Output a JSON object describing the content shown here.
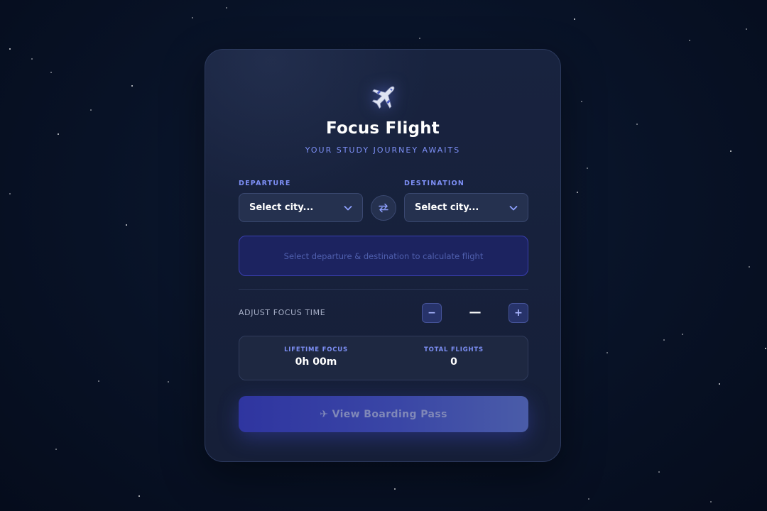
{
  "app": {
    "title": "Focus Flight",
    "subtitle": "YOUR STUDY JOURNEY AWAITS"
  },
  "route": {
    "departure_label": "DEPARTURE",
    "departure_value": "Select city...",
    "destination_label": "DESTINATION",
    "destination_value": "Select city...",
    "swap_icon": "swap-arrows-icon"
  },
  "flight_info": {
    "message": "Select departure & destination to calculate flight"
  },
  "focus_time": {
    "label": "ADJUST FOCUS TIME",
    "decrement_label": "−",
    "value": "—",
    "increment_label": "+"
  },
  "stats": {
    "lifetime_label": "LIFETIME FOCUS",
    "lifetime_value": "0h 00m",
    "flights_label": "TOTAL FLIGHTS",
    "flights_value": "0"
  },
  "actions": {
    "boarding_pass_label": "✈ View Boarding Pass"
  },
  "colors": {
    "background": "#081226",
    "card": "#18233f",
    "accent": "#7d8ff5",
    "button": "#3a46a6"
  }
}
